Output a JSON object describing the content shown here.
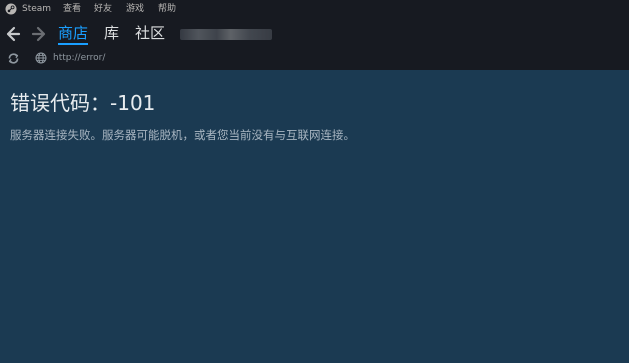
{
  "menubar": {
    "app_name": "Steam",
    "items": [
      "查看",
      "好友",
      "游戏",
      "帮助"
    ]
  },
  "nav": {
    "back_icon": "arrow-left-icon",
    "forward_icon": "arrow-right-icon",
    "tabs": [
      "商店",
      "库",
      "社区"
    ],
    "active_tab": "商店"
  },
  "address": {
    "reload_icon": "reload-icon",
    "globe_icon": "globe-icon",
    "url": "http://error/"
  },
  "page": {
    "error_title": "错误代码：-101",
    "error_message": "服务器连接失败。服务器可能脱机，或者您当前没有与互联网连接。"
  },
  "colors": {
    "chrome_bg": "#171a21",
    "content_bg": "#1b3a52",
    "accent": "#1a9fff"
  }
}
